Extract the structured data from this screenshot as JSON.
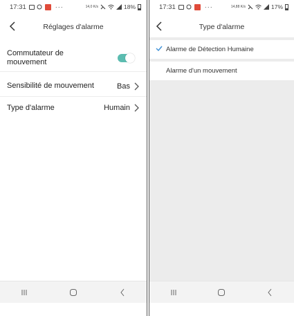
{
  "left": {
    "status": {
      "time": "17:31",
      "battery": "18%",
      "data_speed": "14,0 K/s"
    },
    "header": {
      "title": "Réglages d'alarme"
    },
    "rows": [
      {
        "label": "Commutateur de mouvement",
        "toggle_on": true
      },
      {
        "label": "Sensibilité de mouvement",
        "value": "Bas"
      },
      {
        "label": "Type d'alarme",
        "value": "Humain"
      }
    ]
  },
  "right": {
    "status": {
      "time": "17:31",
      "battery": "17%",
      "data_speed": "14,88 K/s"
    },
    "header": {
      "title": "Type d'alarme"
    },
    "options": [
      {
        "label": "Alarme de Détection Humaine",
        "selected": true
      },
      {
        "label": "Alarme d'un mouvement",
        "selected": false
      }
    ]
  },
  "colors": {
    "accent": "#5bbcb0",
    "check": "#3b8fd6",
    "background_gray": "#ececec"
  },
  "icons": [
    "gallery-icon",
    "cloud-icon",
    "notification-icon",
    "mute-icon",
    "wifi-icon",
    "signal-icon",
    "battery-icon",
    "back-icon",
    "chevron-right-icon",
    "checkmark-icon",
    "nav-recents-icon",
    "nav-home-icon",
    "nav-back-icon"
  ]
}
